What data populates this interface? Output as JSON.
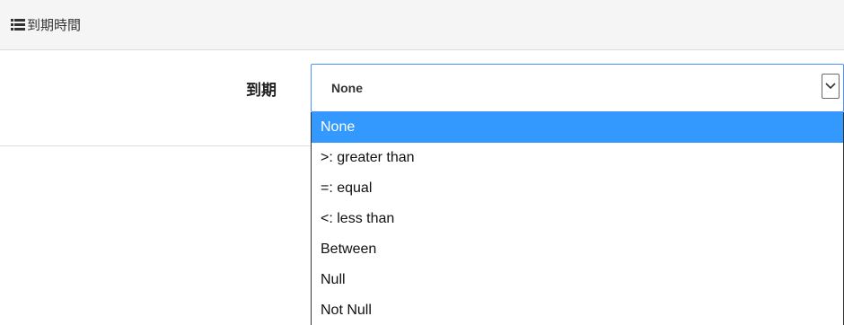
{
  "panel": {
    "heading_icon": "list-icon",
    "heading_title": "到期時間"
  },
  "form": {
    "field_label": "到期",
    "select": {
      "selected_value": "None",
      "arrow_icon": "chevron-down-icon"
    },
    "dropdown": {
      "options": [
        "None",
        ">: greater than",
        "=: equal",
        "<: less than",
        "Between",
        "Null",
        "Not Null"
      ],
      "highlighted_index": 0
    }
  },
  "colors": {
    "highlight": "#3399ff",
    "focus_border": "#4d90fe",
    "heading_background": "#f5f5f5"
  }
}
